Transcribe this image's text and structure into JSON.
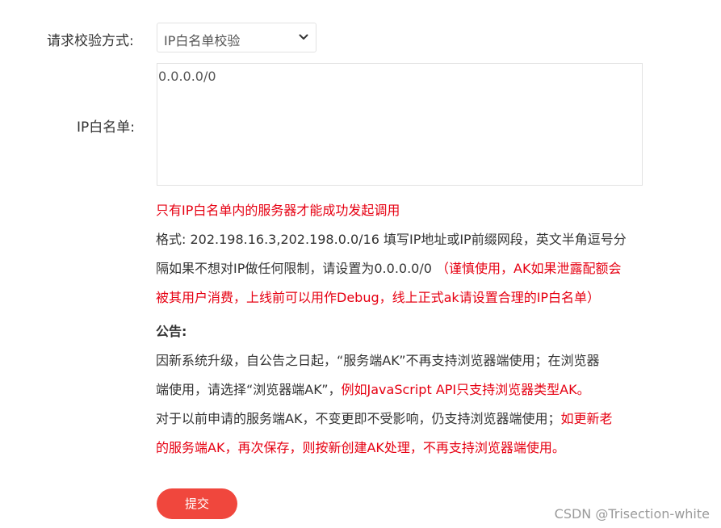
{
  "form": {
    "method_label": "请求校验方式:",
    "method_value": "IP白名单校验",
    "whitelist_label": "IP白名单:",
    "whitelist_value": "0.0.0.0/0"
  },
  "notes": {
    "line1": "只有IP白名单内的服务器才能成功发起调用",
    "line2": "格式: 202.198.16.3,202.198.0.0/16 填写IP地址或IP前缀网段，英文半角逗号分",
    "line3_dark": "隔如果不想对IP做任何限制，请设置为0.0.0.0/0 ",
    "line3_red": "（谨慎使用，AK如果泄露配额会",
    "line4": "被其用户消费，上线前可以用作Debug，线上正式ak请设置合理的IP白名单）"
  },
  "announcement": {
    "title": "公告:",
    "line1": "因新系统升级，自公告之日起，“服务端AK”不再支持浏览器端使用；在浏览器",
    "line2_dark": "端使用，请选择“浏览器端AK”，",
    "line2_red": "例如JavaScript API只支持浏览器类型AK。",
    "line3_dark": "对于以前申请的服务端AK，不变更即不受影响，仍支持浏览器端使用；",
    "line3_red": "如更新老",
    "line4": "的服务端AK，再次保存，则按新创建AK处理，不再支持浏览器端使用。"
  },
  "submit_label": "提交",
  "watermark": "CSDN @Trisection-white",
  "colors": {
    "warning_red": "#e60012",
    "button": "#f0473d",
    "text": "#333333"
  },
  "icons": {
    "select_arrow": "chevron-down-icon"
  }
}
